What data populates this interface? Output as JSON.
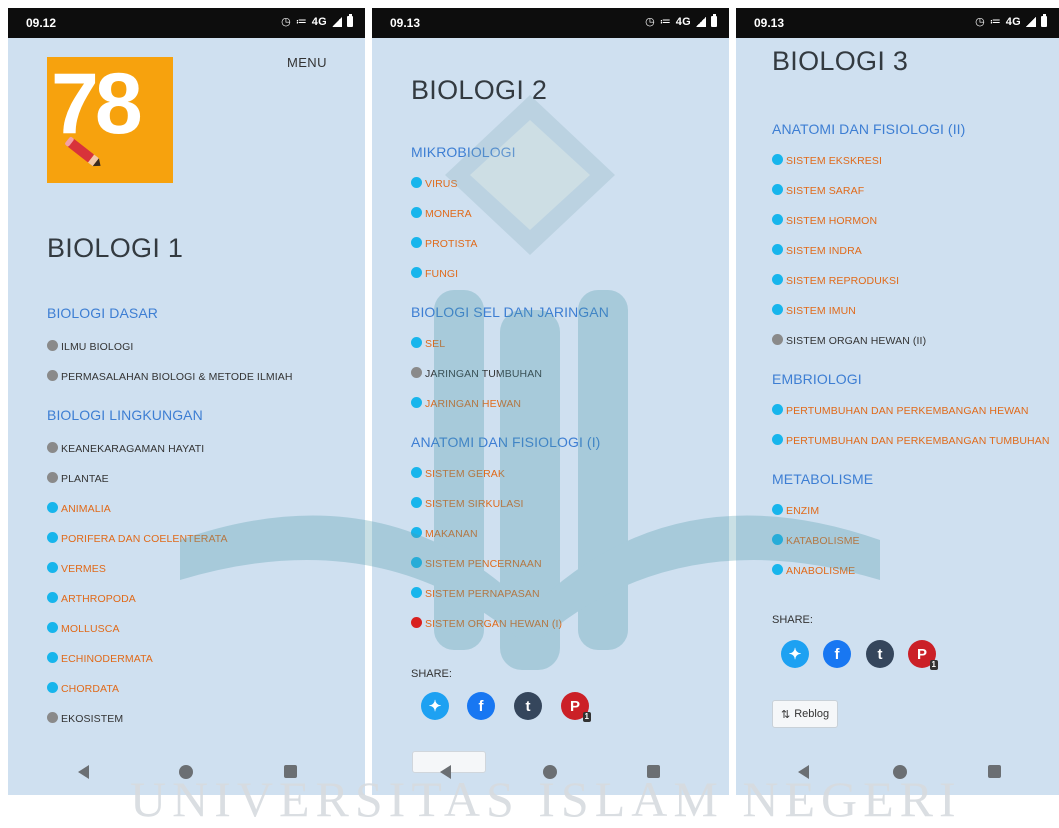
{
  "watermark_text": "UNIVERSITAS ISLAM NEGERI",
  "screen1": {
    "status": {
      "time": "09.12",
      "network": "4G"
    },
    "menu_label": "MENU",
    "logo_number": "78",
    "page_title": "BIOLOGI 1",
    "sections": [
      {
        "heading": "BIOLOGI DASAR",
        "items": [
          {
            "label": "ILMU BIOLOGI",
            "state": "plain"
          },
          {
            "label": "PERMASALAHAN BIOLOGI & METODE ILMIAH",
            "state": "plain"
          }
        ]
      },
      {
        "heading": "BIOLOGI LINGKUNGAN",
        "items": [
          {
            "label": "KEANEKARAGAMAN HAYATI",
            "state": "plain"
          },
          {
            "label": "PLANTAE",
            "state": "plain"
          },
          {
            "label": "ANIMALIA",
            "state": "link"
          },
          {
            "label": "PORIFERA DAN COELENTERATA",
            "state": "link"
          },
          {
            "label": "VERMES",
            "state": "link"
          },
          {
            "label": "ARTHROPODA",
            "state": "link"
          },
          {
            "label": "MOLLUSCA",
            "state": "link"
          },
          {
            "label": "ECHINODERMATA",
            "state": "link"
          },
          {
            "label": "CHORDATA",
            "state": "link"
          },
          {
            "label": "EKOSISTEM",
            "state": "plain"
          }
        ]
      }
    ]
  },
  "screen2": {
    "status": {
      "time": "09.13",
      "network": "4G"
    },
    "page_title": "BIOLOGI 2",
    "sections": [
      {
        "heading": "MIKROBIOLOGI",
        "items": [
          {
            "label": "VIRUS",
            "state": "link"
          },
          {
            "label": "MONERA",
            "state": "link"
          },
          {
            "label": "PROTISTA",
            "state": "link"
          },
          {
            "label": "FUNGI",
            "state": "link"
          }
        ]
      },
      {
        "heading": "BIOLOGI SEL DAN JARINGAN",
        "items": [
          {
            "label": "SEL",
            "state": "link"
          },
          {
            "label": "JARINGAN TUMBUHAN",
            "state": "plain"
          },
          {
            "label": "JARINGAN HEWAN",
            "state": "link"
          }
        ]
      },
      {
        "heading": "ANATOMI DAN FISIOLOGI (I)",
        "items": [
          {
            "label": "SISTEM GERAK",
            "state": "link"
          },
          {
            "label": "SISTEM SIRKULASI",
            "state": "link"
          },
          {
            "label": "MAKANAN",
            "state": "link"
          },
          {
            "label": "SISTEM PENCERNAAN",
            "state": "link"
          },
          {
            "label": "SISTEM PERNAPASAN",
            "state": "link"
          },
          {
            "label": "SISTEM ORGAN HEWAN (I)",
            "state": "active"
          }
        ]
      }
    ],
    "share_label": "SHARE:",
    "pinterest_count": "1"
  },
  "screen3": {
    "status": {
      "time": "09.13",
      "network": "4G"
    },
    "page_title": "BIOLOGI 3",
    "sections": [
      {
        "heading": "ANATOMI DAN FISIOLOGI (II)",
        "items": [
          {
            "label": "SISTEM EKSKRESI",
            "state": "link"
          },
          {
            "label": "SISTEM SARAF",
            "state": "link"
          },
          {
            "label": "SISTEM HORMON",
            "state": "link"
          },
          {
            "label": "SISTEM INDRA",
            "state": "link"
          },
          {
            "label": "SISTEM REPRODUKSI",
            "state": "link"
          },
          {
            "label": "SISTEM IMUN",
            "state": "link"
          },
          {
            "label": "SISTEM ORGAN HEWAN (II)",
            "state": "plain"
          }
        ]
      },
      {
        "heading": "EMBRIOLOGI",
        "items": [
          {
            "label": "PERTUMBUHAN DAN PERKEMBANGAN HEWAN",
            "state": "link"
          },
          {
            "label": "PERTUMBUHAN DAN PERKEMBANGAN TUMBUHAN",
            "state": "link"
          }
        ]
      },
      {
        "heading": "METABOLISME",
        "items": [
          {
            "label": "ENZIM",
            "state": "link"
          },
          {
            "label": "KATABOLISME",
            "state": "link"
          },
          {
            "label": "ANABOLISME",
            "state": "link"
          }
        ]
      }
    ],
    "share_label": "SHARE:",
    "pinterest_count": "1",
    "reblog_label": "Reblog"
  },
  "colors": {
    "page_bg": "#cfe0f0",
    "heading_blue": "#3d7ed3",
    "link_orange": "#e06a1a",
    "link_dot": "#17b5ec",
    "plain_dot": "#8a8a8a",
    "active_dot": "#d8201f",
    "logo_bg": "#f7a20d"
  }
}
